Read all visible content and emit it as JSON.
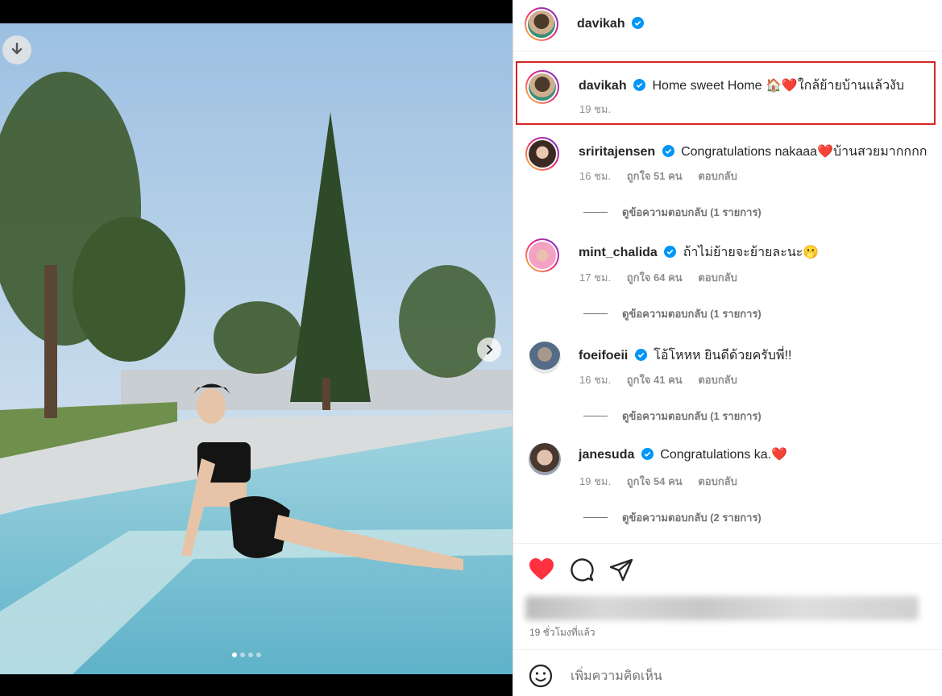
{
  "post": {
    "author": "davikah",
    "carousel_total": 4,
    "carousel_active": 1
  },
  "caption": {
    "username": "davikah",
    "text": "Home sweet Home 🏠❤️ใกล้ย้ายบ้านแล้วงับ",
    "time": "19 ชม."
  },
  "comments": [
    {
      "username": "sriritajensen",
      "text": "Congratulations nakaaa❤️บ้านสวยมากกกก",
      "time": "16 ชม.",
      "likes": "ถูกใจ 51 คน",
      "reply": "ตอบกลับ",
      "view_replies": "ดูข้อความตอบกลับ (1 รายการ)"
    },
    {
      "username": "mint_chalida",
      "text": "ถ้าไม่ย้ายจะย้ายละนะ🫢",
      "time": "17 ชม.",
      "likes": "ถูกใจ 64 คน",
      "reply": "ตอบกลับ",
      "view_replies": "ดูข้อความตอบกลับ (1 รายการ)"
    },
    {
      "username": "foeifoeii",
      "text": "โอ้โหหห ยินดีด้วยครับพี่!!",
      "time": "16 ชม.",
      "likes": "ถูกใจ 41 คน",
      "reply": "ตอบกลับ",
      "view_replies": "ดูข้อความตอบกลับ (1 รายการ)"
    },
    {
      "username": "janesuda",
      "text": "Congratulations ka.❤️",
      "time": "19 ชม.",
      "likes": "ถูกใจ 54 คน",
      "reply": "ตอบกลับ",
      "view_replies": "ดูข้อความตอบกลับ (2 รายการ)"
    }
  ],
  "footer": {
    "posted_ago": "19 ชั่วโมงที่แล้ว",
    "add_comment_placeholder": "เพิ่มความคิดเห็น"
  },
  "icons": {
    "download": "download-icon",
    "next": "chevron-right-icon",
    "like": "heart-icon",
    "comment": "comment-icon",
    "share": "share-icon",
    "emoji": "emoji-icon",
    "verified": "verified-badge-icon"
  },
  "colors": {
    "like_red": "#ff3040",
    "verified_blue": "#0095f6",
    "highlight_red": "#d62424",
    "sky": "#b9d3ea",
    "pool": "#7fc3d6"
  }
}
